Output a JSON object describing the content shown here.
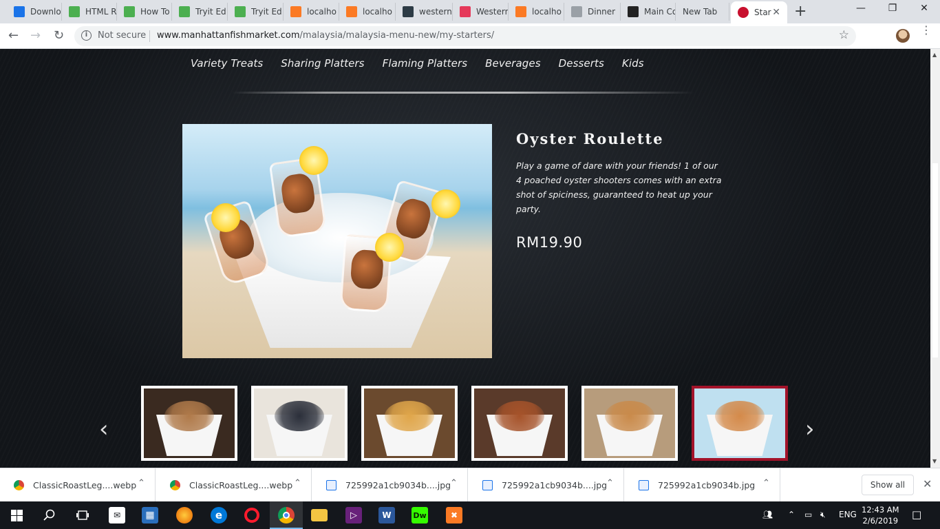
{
  "browser": {
    "tabs": [
      {
        "label": "Downlo",
        "icon": "download-icon",
        "color": "#1a73e8"
      },
      {
        "label": "HTML R",
        "icon": "w3schools-icon",
        "color": "#4caf50"
      },
      {
        "label": "How To",
        "icon": "w3schools-icon",
        "color": "#4caf50"
      },
      {
        "label": "Tryit Ed",
        "icon": "w3schools-icon",
        "color": "#4caf50"
      },
      {
        "label": "Tryit Ed",
        "icon": "w3schools-icon",
        "color": "#4caf50"
      },
      {
        "label": "localho",
        "icon": "xampp-icon",
        "color": "#fb7a24"
      },
      {
        "label": "localho",
        "icon": "xampp-icon",
        "color": "#fb7a24"
      },
      {
        "label": "western",
        "icon": "site-icon",
        "color": "#2d3b45"
      },
      {
        "label": "Western",
        "icon": "play-icon",
        "color": "#e5395a"
      },
      {
        "label": "localho",
        "icon": "xampp-icon",
        "color": "#fb7a24"
      },
      {
        "label": "Dinner",
        "icon": "image-icon",
        "color": "#9aa0a6"
      },
      {
        "label": "Main Co",
        "icon": "s-icon",
        "color": "#222222"
      },
      {
        "label": "New Tab",
        "icon": "",
        "color": ""
      }
    ],
    "active_tab": {
      "label": "Star",
      "icon": "manhattan-fish-icon",
      "color": "#c8102e"
    },
    "new_tab": "+",
    "omnibox": {
      "security": "Not secure",
      "host": "www.manhattanfishmarket.com",
      "path": "/malaysia/malaysia-menu-new/my-starters/"
    }
  },
  "page": {
    "menu_nav": [
      "Variety Treats",
      "Sharing Platters",
      "Flaming Platters",
      "Beverages",
      "Desserts",
      "Kids"
    ],
    "dish": {
      "title": "Oyster Roulette",
      "description": "Play a game of dare with your friends! 1 of our 4 poached oyster shooters comes with an extra shot of spiciness, guaranteed to heat up your party.",
      "price": "RM19.90"
    },
    "carousel": {
      "prev": "‹",
      "next": "›",
      "thumbnails": [
        {
          "food_color": "#b07a4a",
          "bg": "#3a2a20"
        },
        {
          "food_color": "#2b2f3a",
          "bg": "#e9e4dc"
        },
        {
          "food_color": "#e0a64a",
          "bg": "#6b4a2e"
        },
        {
          "food_color": "#a6532a",
          "bg": "#5a3a2a"
        },
        {
          "food_color": "#c98a4a",
          "bg": "#b79c7c"
        },
        {
          "food_color": "#d48a4a",
          "bg": "#bfe0f0"
        }
      ],
      "selected_index": 5
    }
  },
  "downloads": {
    "items": [
      {
        "name": "ClassicRoastLeg....webp",
        "icon": "chrome-icon"
      },
      {
        "name": "ClassicRoastLeg....webp",
        "icon": "chrome-icon"
      },
      {
        "name": "725992a1cb9034b....jpg",
        "icon": "image-file-icon"
      },
      {
        "name": "725992a1cb9034b....jpg",
        "icon": "image-file-icon"
      },
      {
        "name": "725992a1cb9034b.jpg",
        "icon": "image-file-icon"
      }
    ],
    "show_all": "Show all"
  },
  "taskbar": {
    "lang": "ENG",
    "time": "12:43 AM",
    "date": "2/6/2019",
    "accent": "#76b9ed"
  }
}
